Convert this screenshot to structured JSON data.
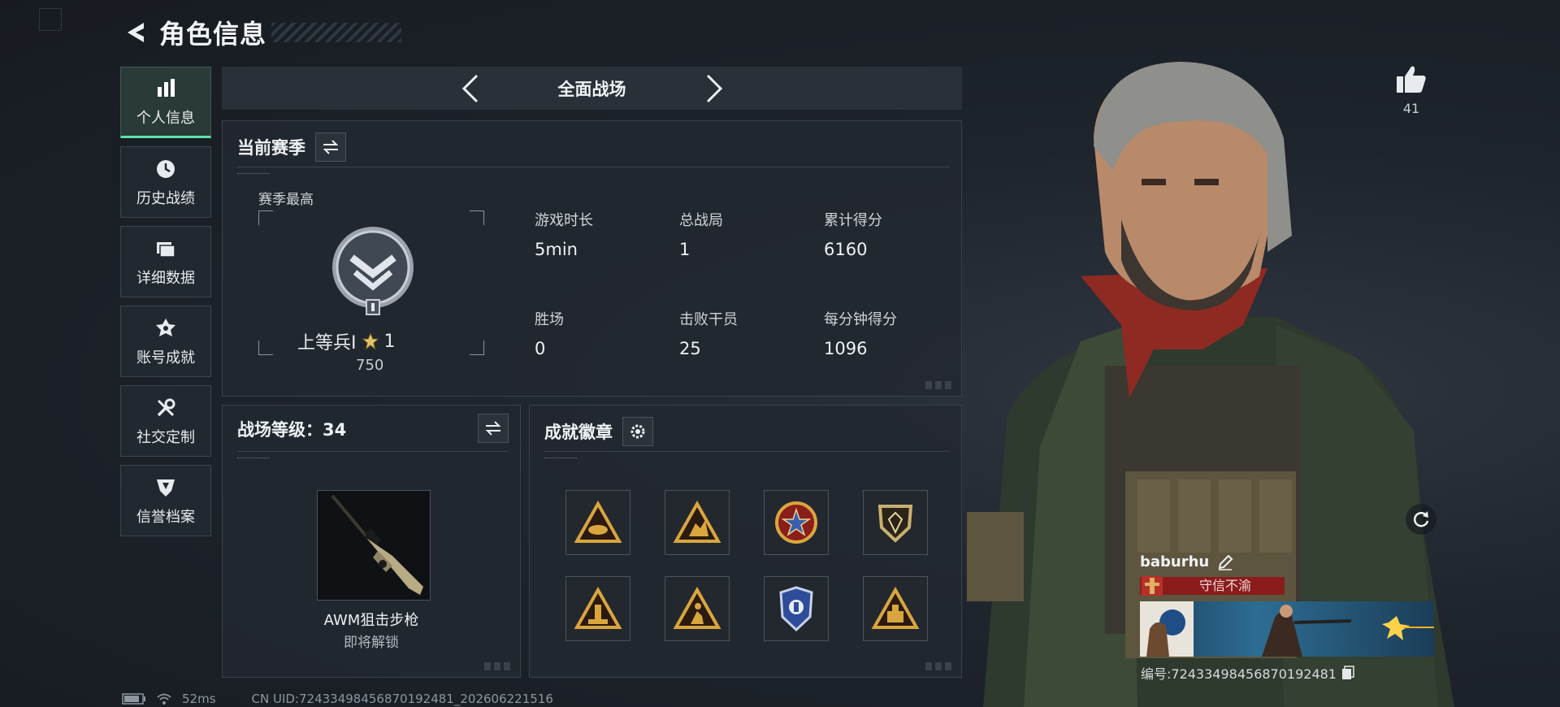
{
  "header": {
    "title": "角色信息"
  },
  "sidebar": {
    "items": [
      {
        "label": "个人信息",
        "icon": "bar-chart-icon",
        "active": true
      },
      {
        "label": "历史战绩",
        "icon": "clock-icon",
        "active": false
      },
      {
        "label": "详细数据",
        "icon": "folder-icon",
        "active": false
      },
      {
        "label": "账号成就",
        "icon": "medal-icon",
        "active": false
      },
      {
        "label": "社交定制",
        "icon": "wrench-icon",
        "active": false
      },
      {
        "label": "信誉档案",
        "icon": "shield-icon",
        "active": false
      }
    ]
  },
  "mode": {
    "label": "全面战场"
  },
  "season": {
    "title": "当前赛季",
    "best_label": "赛季最高",
    "rank_name": "上等兵Ⅰ",
    "rank_stars": "1",
    "rank_points": "750",
    "stats": [
      {
        "key": "游戏时长",
        "value": "5min"
      },
      {
        "key": "总战局",
        "value": "1"
      },
      {
        "key": "累计得分",
        "value": "6160"
      },
      {
        "key": "胜场",
        "value": "0"
      },
      {
        "key": "击败干员",
        "value": "25"
      },
      {
        "key": "每分钟得分",
        "value": "1096"
      }
    ]
  },
  "battle_level": {
    "title": "战场等级：34",
    "weapon_name": "AWM狙击步枪",
    "weapon_status": "即将解锁"
  },
  "badges": {
    "title": "成就徽章",
    "items": [
      {
        "icon": "triangle-eye-badge-icon"
      },
      {
        "icon": "triangle-figure-badge-icon"
      },
      {
        "icon": "star-emblem-badge-icon"
      },
      {
        "icon": "shield-crest-badge-icon"
      },
      {
        "icon": "triangle-tower-badge-icon"
      },
      {
        "icon": "triangle-runner-badge-icon"
      },
      {
        "icon": "police-shield-badge-icon"
      },
      {
        "icon": "triangle-box-badge-icon"
      }
    ]
  },
  "likes": {
    "count": "41"
  },
  "player_card": {
    "name": "baburhu",
    "title": "守信不渝",
    "id_label": "编号:7243349845687019248​1"
  },
  "status_bar": {
    "ping": "52ms",
    "uid": "CN UID:7243349845687019248​1_202606221516"
  },
  "colors": {
    "accent": "#5ee0a8",
    "title_red": "#8a1c1c",
    "background": "#1d2229"
  }
}
